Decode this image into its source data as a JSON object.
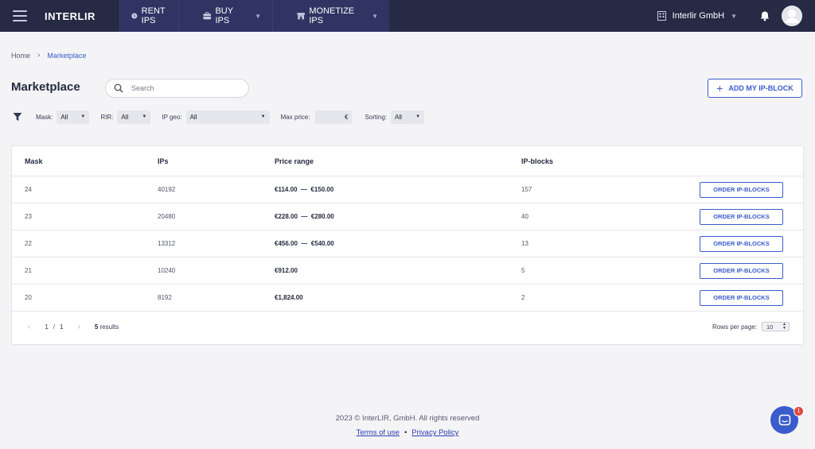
{
  "nav": {
    "logo": "INTERLIR",
    "tabs": [
      {
        "label": "RENT IPS"
      },
      {
        "label": "BUY IPS"
      },
      {
        "label": "MONETIZE IPS"
      }
    ],
    "company": "Interlir GmbH"
  },
  "breadcrumb": {
    "home": "Home",
    "current": "Marketplace"
  },
  "page": {
    "title": "Marketplace",
    "search_placeholder": "Search",
    "add_button": "ADD MY IP-BLOCK"
  },
  "filters": {
    "mask_label": "Mask:",
    "mask_value": "All",
    "rir_label": "RIR:",
    "rir_value": "All",
    "geo_label": "IP geo:",
    "geo_value": "All",
    "price_label": "Max price:",
    "price_currency": "€",
    "sorting_label": "Sorting:",
    "sorting_value": "All"
  },
  "table": {
    "headers": {
      "mask": "Mask",
      "ips": "IPs",
      "price": "Price range",
      "blocks": "IP-blocks"
    },
    "order_label": "ORDER IP-BLOCKS",
    "rows": [
      {
        "mask": "24",
        "ips": "40192",
        "price": "€114.00  —  €150.00",
        "blocks": "157"
      },
      {
        "mask": "23",
        "ips": "20480",
        "price": "€228.00  —  €280.00",
        "blocks": "40"
      },
      {
        "mask": "22",
        "ips": "13312",
        "price": "€456.00  —  €540.00",
        "blocks": "13"
      },
      {
        "mask": "21",
        "ips": "10240",
        "price": "€912.00",
        "blocks": "5"
      },
      {
        "mask": "20",
        "ips": "8192",
        "price": "€1,824.00",
        "blocks": "2"
      }
    ]
  },
  "pagination": {
    "page": "1",
    "total": "1",
    "results_count": "5",
    "results_label": "results",
    "rows_label": "Rows per page:",
    "rows_value": "10"
  },
  "footer": {
    "copyright": "2023 © InterLIR, GmbH. All rights reserved",
    "terms": "Terms of use",
    "privacy": "Privacy Policy"
  },
  "chat": {
    "badge": "1"
  },
  "colors": {
    "nav_bg": "#262a45",
    "accent": "#3a5ccc",
    "badge": "#e0483e"
  }
}
